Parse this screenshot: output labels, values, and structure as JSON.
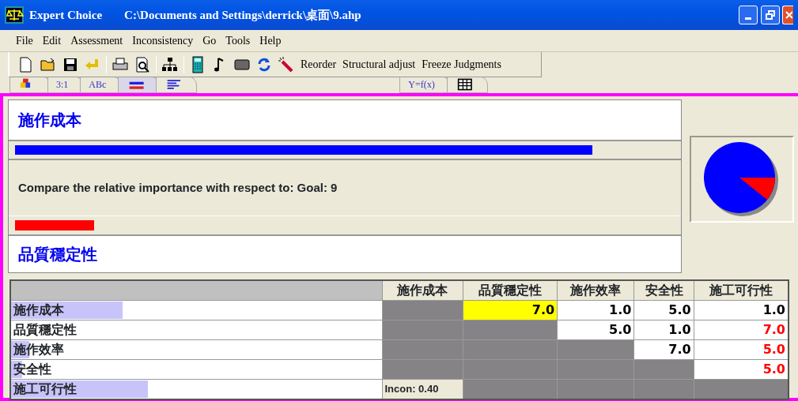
{
  "window": {
    "title": "Expert Choice",
    "path": "C:\\Documents and Settings\\derrick\\桌面\\9.ahp"
  },
  "menu": [
    "File",
    "Edit",
    "Assessment",
    "Inconsistency",
    "Go",
    "Tools",
    "Help"
  ],
  "toolbar": [
    {
      "kind": "text",
      "label": "Reorder"
    },
    {
      "kind": "text",
      "label": "Structural adjust"
    },
    {
      "kind": "text",
      "label": "Freeze Judgments"
    }
  ],
  "tabs": [
    {
      "kind": "icon",
      "selected": false
    },
    {
      "kind": "text",
      "label": "3:1",
      "selected": false
    },
    {
      "kind": "text",
      "label": "ABc",
      "selected": false
    },
    {
      "kind": "icon",
      "selected": true
    },
    {
      "kind": "icon",
      "selected": false
    },
    {
      "kind": "text",
      "label": "Y=f(x)",
      "selected": false
    },
    {
      "kind": "icon",
      "selected": false
    }
  ],
  "comparison": {
    "top_item": "施作成本",
    "prompt": "Compare the relative importance  with respect to: Goal: 9",
    "bottom_item": "品質穩定性"
  },
  "matrix": {
    "columns": [
      "施作成本",
      "品質穩定性",
      "施作效率",
      "安全性",
      "施工可行性"
    ],
    "rows": [
      {
        "label": "施作成本",
        "level": 0.3,
        "cells": [
          {
            "kind": "blank"
          },
          {
            "kind": "value",
            "text": "7.0",
            "inverted": false,
            "selected": true
          },
          {
            "kind": "value",
            "text": "1.0",
            "inverted": false,
            "selected": false
          },
          {
            "kind": "value",
            "text": "5.0",
            "inverted": false,
            "selected": false
          },
          {
            "kind": "value",
            "text": "1.0",
            "inverted": false,
            "selected": false
          }
        ]
      },
      {
        "label": "品質穩定性",
        "cells": [
          {
            "kind": "blank"
          },
          {
            "kind": "blank"
          },
          {
            "kind": "value",
            "text": "5.0",
            "inverted": false,
            "selected": false
          },
          {
            "kind": "value",
            "text": "1.0",
            "inverted": false,
            "selected": false
          },
          {
            "kind": "value",
            "text": "7.0",
            "inverted": true,
            "selected": false
          }
        ]
      },
      {
        "label": "施作效率",
        "level": 0.05,
        "cells": [
          {
            "kind": "blank"
          },
          {
            "kind": "blank"
          },
          {
            "kind": "blank"
          },
          {
            "kind": "value",
            "text": "7.0",
            "inverted": false,
            "selected": false
          },
          {
            "kind": "value",
            "text": "5.0",
            "inverted": true,
            "selected": false
          }
        ]
      },
      {
        "label": "安全性",
        "level": 0.03,
        "cells": [
          {
            "kind": "blank"
          },
          {
            "kind": "blank"
          },
          {
            "kind": "blank"
          },
          {
            "kind": "blank"
          },
          {
            "kind": "value",
            "text": "5.0",
            "inverted": true,
            "selected": false
          }
        ]
      },
      {
        "label": "施工可行性",
        "level": 0.37,
        "cells": [
          {
            "kind": "incon",
            "text": "Incon: 0.40"
          },
          {
            "kind": "blank"
          },
          {
            "kind": "blank"
          },
          {
            "kind": "blank"
          },
          {
            "kind": "blank"
          }
        ]
      }
    ]
  }
}
